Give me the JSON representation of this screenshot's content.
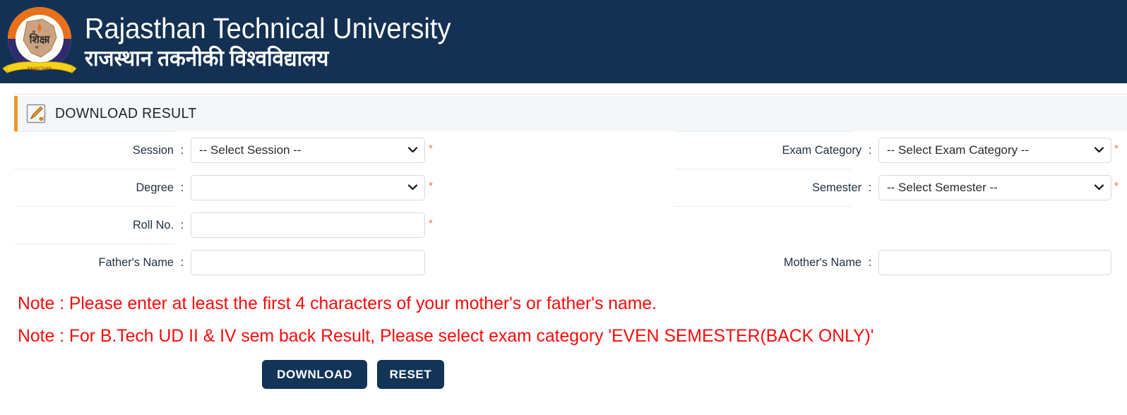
{
  "header": {
    "title_en": "Rajasthan Technical University",
    "title_hi": "राजस्थान तकनीकी विश्वविद्यालय",
    "bg_color": "#143153",
    "logo_alt": "rtu-emblem"
  },
  "panel": {
    "title": "DOWNLOAD RESULT",
    "accent_color": "#f0952b",
    "bg_color": "#f4f7fa"
  },
  "form": {
    "left": [
      {
        "label": "Session",
        "colon": ":",
        "type": "select",
        "value": "-- Select Session --",
        "required": true,
        "required_mark": "*",
        "name": "session"
      },
      {
        "label": "Degree",
        "colon": ":",
        "type": "select",
        "value": "",
        "required": true,
        "required_mark": "*",
        "name": "degree"
      },
      {
        "label": "Roll No.",
        "colon": ":",
        "type": "text",
        "value": "",
        "placeholder": "",
        "required": true,
        "required_mark": "*",
        "name": "roll-no"
      },
      {
        "label": "Father's Name",
        "colon": ":",
        "type": "text",
        "value": "",
        "placeholder": "",
        "required": false,
        "required_mark": "",
        "name": "fathers-name"
      }
    ],
    "right": [
      {
        "label": "Exam Category",
        "colon": ":",
        "type": "select",
        "value": "-- Select Exam Category --",
        "required": true,
        "required_mark": "*",
        "name": "exam-category"
      },
      {
        "label": "Semester",
        "colon": ":",
        "type": "select",
        "value": "-- Select Semester --",
        "required": true,
        "required_mark": "*",
        "name": "semester"
      },
      {
        "label": "",
        "colon": "",
        "type": "none",
        "value": "",
        "required": false,
        "required_mark": "",
        "name": "spacer"
      },
      {
        "label": "Mother's Name",
        "colon": ":",
        "type": "text",
        "value": "",
        "placeholder": "",
        "required": false,
        "required_mark": "",
        "name": "mothers-name"
      }
    ]
  },
  "notes": {
    "color": "#fb0b0b",
    "lines": [
      "Note : Please enter at least the first 4 characters of your mother's or father's name.",
      "Note : For B.Tech UD II & IV sem back Result, Please select exam category 'EVEN SEMESTER(BACK ONLY)'"
    ]
  },
  "buttons": {
    "download_label": "DOWNLOAD",
    "reset_label": "RESET",
    "bg_color": "#123457"
  }
}
